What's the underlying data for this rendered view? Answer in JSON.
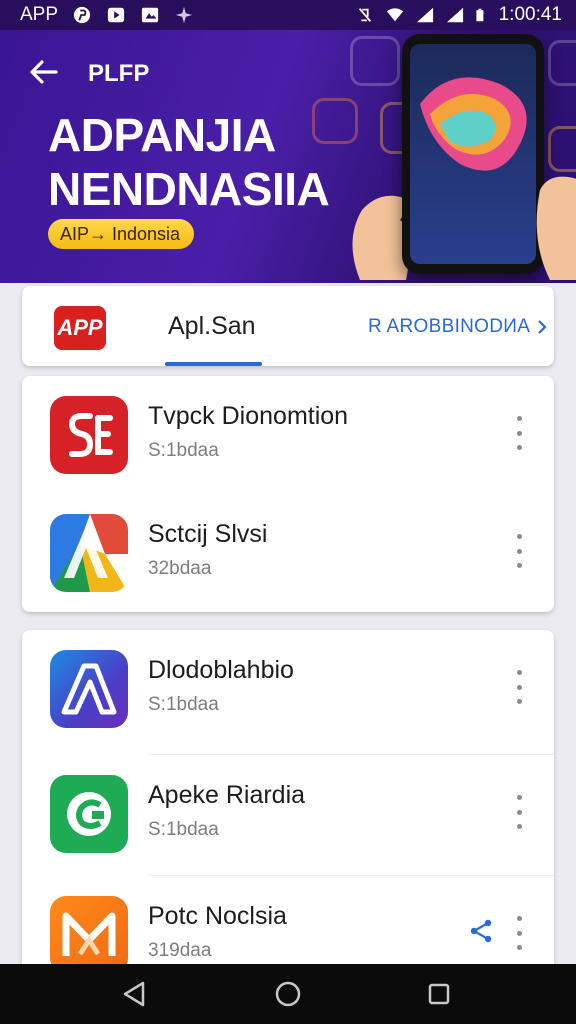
{
  "status_bar": {
    "app_label": "APP",
    "time": "1:00:41"
  },
  "hero": {
    "label": "PLFP",
    "title_line1": "ADPANJIA",
    "title_line2": "NENDNASIIA",
    "pill_text": "AIP→ Indonsia"
  },
  "tabs": {
    "logo_text": "APP",
    "active": "Apl.San",
    "more": "R AROBBINODИA"
  },
  "apps": [
    {
      "name": "Tvpck Dionomtion",
      "meta": "S:1bdaa",
      "icon": "red-s-icon"
    },
    {
      "name": "Sctcij Slvsi",
      "meta": "32bdaa",
      "icon": "multicolor-a-icon"
    },
    {
      "name": "Dlodoblahbio",
      "meta": "S:1bdaa",
      "icon": "blue-a-icon"
    },
    {
      "name": "Apeke Riardia",
      "meta": "S:1bdaa",
      "icon": "green-c-icon"
    },
    {
      "name": "Potc Noclsia",
      "meta": "319daa",
      "icon": "orange-m-icon"
    }
  ],
  "colors": {
    "accent": "#2a6ad6",
    "banner": "#3a1593",
    "pill": "#f4bb12"
  }
}
